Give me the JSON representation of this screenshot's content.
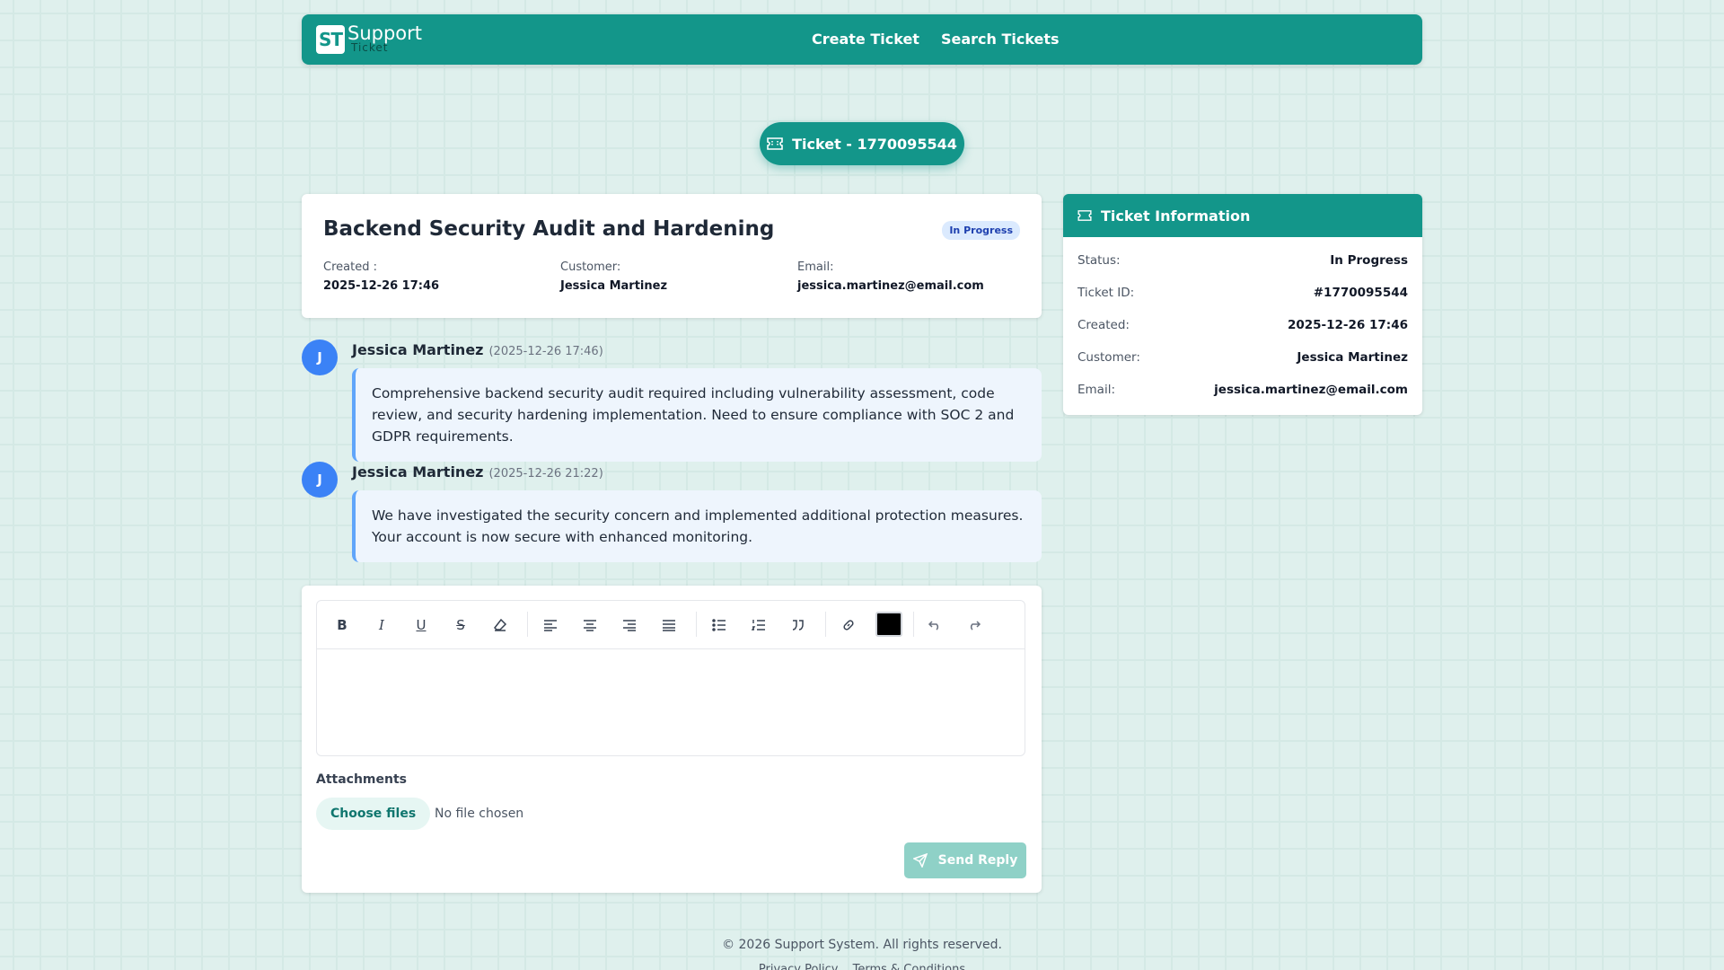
{
  "header": {
    "logo_badge": "ST",
    "logo_main": "Support",
    "logo_sub": "Ticket",
    "nav": [
      "Create Ticket",
      "Search Tickets"
    ]
  },
  "ticket_pill": "Ticket - 1770095544",
  "ticket": {
    "title": "Backend Security Audit and Hardening",
    "status_badge": "In Progress",
    "created_label": "Created :",
    "created_value": "2025-12-26 17:46",
    "customer_label": "Customer:",
    "customer_value": "Jessica Martinez",
    "email_label": "Email:",
    "email_value": "jessica.martinez@email.com"
  },
  "messages": [
    {
      "avatar": "J",
      "author": "Jessica Martinez",
      "time": "(2025-12-26 17:46)",
      "body": "Comprehensive backend security audit required including vulnerability assessment, code review, and security hardening implementation. Need to ensure compliance with SOC 2 and GDPR requirements."
    },
    {
      "avatar": "J",
      "author": "Jessica Martinez",
      "time": "(2025-12-26 21:22)",
      "body": "We have investigated the security concern and implemented additional protection measures. Your account is now secure with enhanced monitoring."
    }
  ],
  "reply": {
    "toolbar_icons": [
      "bold-icon",
      "italic-icon",
      "underline-icon",
      "strikethrough-icon",
      "clear-format-icon",
      "align-left-icon",
      "align-center-icon",
      "align-right-icon",
      "align-justify-icon",
      "bullet-list-icon",
      "ordered-list-icon",
      "quote-icon",
      "link-icon",
      "text-color-icon",
      "undo-icon",
      "redo-icon"
    ],
    "text_color": "#000000",
    "attachments_label": "Attachments",
    "choose_files": "Choose files",
    "no_file": "No file chosen",
    "send_label": "Send Reply"
  },
  "info": {
    "title": "Ticket Information",
    "rows": [
      {
        "k": "Status:",
        "v": "In Progress"
      },
      {
        "k": "Ticket ID:",
        "v": "#1770095544"
      },
      {
        "k": "Created:",
        "v": "2025-12-26 17:46"
      },
      {
        "k": "Customer:",
        "v": "Jessica Martinez"
      },
      {
        "k": "Email:",
        "v": "jessica.martinez@email.com"
      }
    ]
  },
  "footer": {
    "copyright": "© 2026 Support System. All rights reserved.",
    "links": [
      "Privacy Policy",
      "Terms & Conditions"
    ]
  },
  "colors": {
    "primary": "#13968a",
    "avatar": "#3b82f6",
    "badge_bg": "#dbeafe",
    "send_disabled": "#8fd1c7"
  }
}
